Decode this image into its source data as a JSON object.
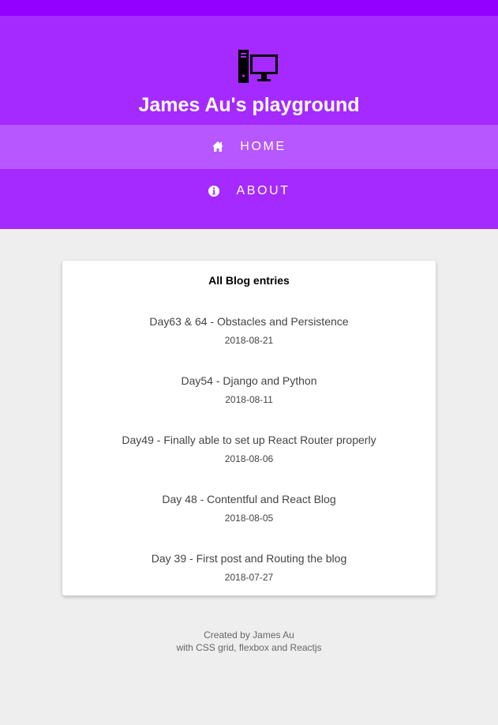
{
  "header": {
    "site_title": "James Au's playground",
    "logo_icon": "computer-tower-monitor-icon",
    "colors": {
      "topbar": "#9400ff",
      "header": "#a52aff",
      "nav_active": "#b657ff"
    }
  },
  "nav": {
    "items": [
      {
        "label": "HOME",
        "icon": "home-icon",
        "active": true
      },
      {
        "label": "ABOUT",
        "icon": "info-icon",
        "active": false
      }
    ]
  },
  "main": {
    "card_title": "All Blog entries",
    "entries": [
      {
        "title": "Day63 & 64 - Obstacles and Persistence",
        "date": "2018-08-21"
      },
      {
        "title": "Day54 - Django and Python",
        "date": "2018-08-11"
      },
      {
        "title": "Day49 - Finally able to set up React Router properly",
        "date": "2018-08-06"
      },
      {
        "title": "Day 48 - Contentful and React Blog",
        "date": "2018-08-05"
      },
      {
        "title": "Day 39 - First post and Routing the blog",
        "date": "2018-07-27"
      }
    ]
  },
  "footer": {
    "line1": "Created by James Au",
    "line2": "with CSS grid, flexbox and Reactjs"
  }
}
